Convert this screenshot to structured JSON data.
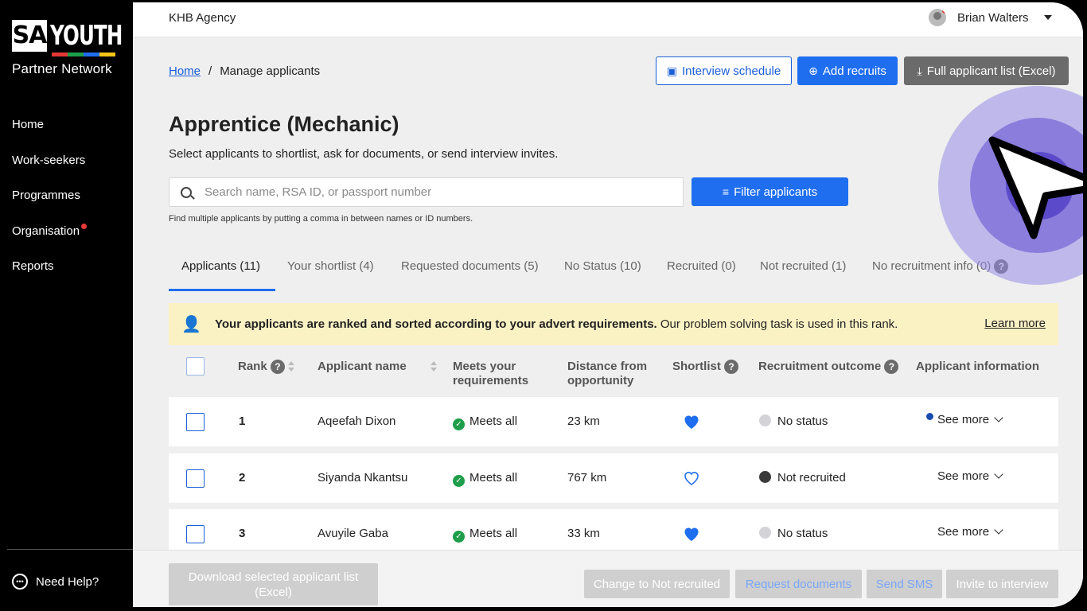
{
  "sidebar": {
    "logo_sa": "SA",
    "logo_youth": "YOUTH",
    "logo_sub": "Partner Network",
    "stripe_colors": [
      "#e53935",
      "#1e9e4a",
      "#1f6ef0",
      "#f5c518"
    ],
    "items": [
      {
        "label": "Home"
      },
      {
        "label": "Work-seekers"
      },
      {
        "label": "Programmes"
      },
      {
        "label": "Organisation",
        "has_dot": true
      },
      {
        "label": "Reports"
      }
    ],
    "help_label": "Need Help?"
  },
  "topbar": {
    "agency": "KHB Agency",
    "user_name": "Brian Walters"
  },
  "breadcrumb": {
    "home": "Home",
    "separator": "/",
    "current": "Manage applicants"
  },
  "actions": {
    "interview_schedule": "Interview schedule",
    "add_recruits": "Add recruits",
    "full_list": "Full applicant list (Excel)"
  },
  "page": {
    "title": "Apprentice (Mechanic)",
    "subtitle": "Select applicants to shortlist, ask for documents, or send interview invites."
  },
  "search": {
    "placeholder": "Search name, RSA ID, or passport number",
    "filter_label": "Filter applicants",
    "hint": "Find multiple applicants by putting a comma in between names or ID numbers."
  },
  "tabs": [
    {
      "label": "Applicants (11)",
      "active": true
    },
    {
      "label": "Your shortlist (4)"
    },
    {
      "label": "Requested documents (5)"
    },
    {
      "label": "No Status (10)"
    },
    {
      "label": "Recruited (0)"
    },
    {
      "label": "Not recruited (1)"
    },
    {
      "label": "No recruitment info (0)"
    }
  ],
  "banner": {
    "bold": "Your applicants are ranked and sorted according to your advert requirements.",
    "text": " Our problem solving task is used in this rank.",
    "link": "Learn more"
  },
  "table": {
    "headers": {
      "rank": "Rank",
      "name": "Applicant name",
      "meets": "Meets your requirements",
      "distance": "Distance from opportunity",
      "shortlist": "Shortlist",
      "outcome": "Recruitment outcome",
      "info": "Applicant information"
    },
    "rows": [
      {
        "rank": "1",
        "name": "Aqeefah Dixon",
        "meets": "Meets all",
        "distance": "23 km",
        "shortlisted": true,
        "outcome": "No status",
        "outcome_color": "#d3d3d8",
        "info": "See more",
        "info_dot": true
      },
      {
        "rank": "2",
        "name": "Siyanda Nkantsu",
        "meets": "Meets all",
        "distance": "767 km",
        "shortlisted": false,
        "outcome": "Not recruited",
        "outcome_color": "#3a3a3a",
        "info": "See more",
        "info_dot": false
      },
      {
        "rank": "3",
        "name": "Avuyile Gaba",
        "meets": "Meets all",
        "distance": "33 km",
        "shortlisted": true,
        "outcome": "No status",
        "outcome_color": "#d3d3d8",
        "info": "See more",
        "info_dot": false
      }
    ]
  },
  "footer": {
    "download": "Download selected applicant list (Excel)",
    "not_recruited": "Change to Not recruited",
    "request_docs": "Request documents",
    "send_sms": "Send SMS",
    "invite": "Invite to interview"
  },
  "colors": {
    "accent": "#1f6ef0",
    "meets": "#1e9e4a",
    "heart": "#1f6ef0"
  }
}
